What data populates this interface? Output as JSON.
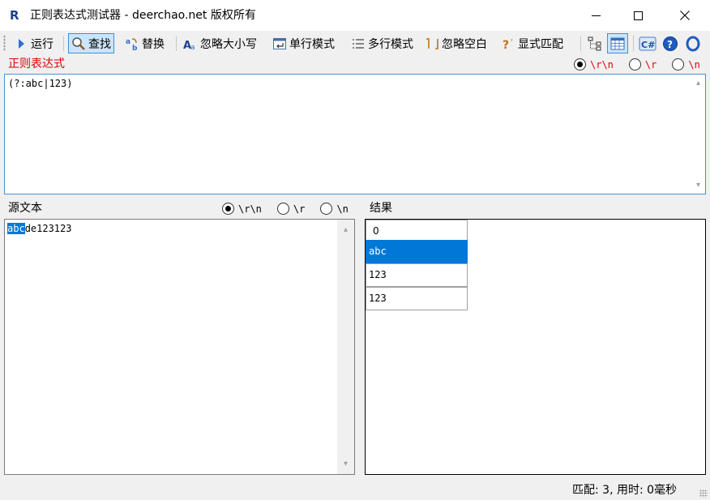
{
  "window": {
    "icon_letter": "R",
    "title": "正则表达式测试器 - deerchao.net 版权所有"
  },
  "toolbar": {
    "run_label": "运行",
    "find_label": "查找",
    "replace_label": "替换",
    "ignore_case_label": "忽略大小写",
    "singleline_label": "单行模式",
    "multiline_label": "多行模式",
    "ignore_whitespace_label": "忽略空白",
    "explicit_capture_label": "显式匹配",
    "csharp_label": "C#",
    "help_label": "?"
  },
  "regex_section": {
    "label": "正则表达式",
    "newline_options": [
      "\\r\\n",
      "\\r",
      "\\n"
    ],
    "selected_newline": "\\r\\n",
    "pattern": "(?:abc|123)"
  },
  "source_section": {
    "label": "源文本",
    "newline_options": [
      "\\r\\n",
      "\\r",
      "\\n"
    ],
    "selected_newline": "\\r\\n",
    "text_selected": "abc",
    "text_rest": "de123123"
  },
  "result_section": {
    "label": "结果",
    "header": "0",
    "matches": [
      "abc",
      "123",
      "123"
    ],
    "selected_index": 0
  },
  "status": {
    "text": "匹配:   3, 用时: 0毫秒"
  },
  "colors": {
    "accent": "#0078d7",
    "regex_label": "#e00000",
    "toolbar_bg": "#f0f0f0"
  }
}
